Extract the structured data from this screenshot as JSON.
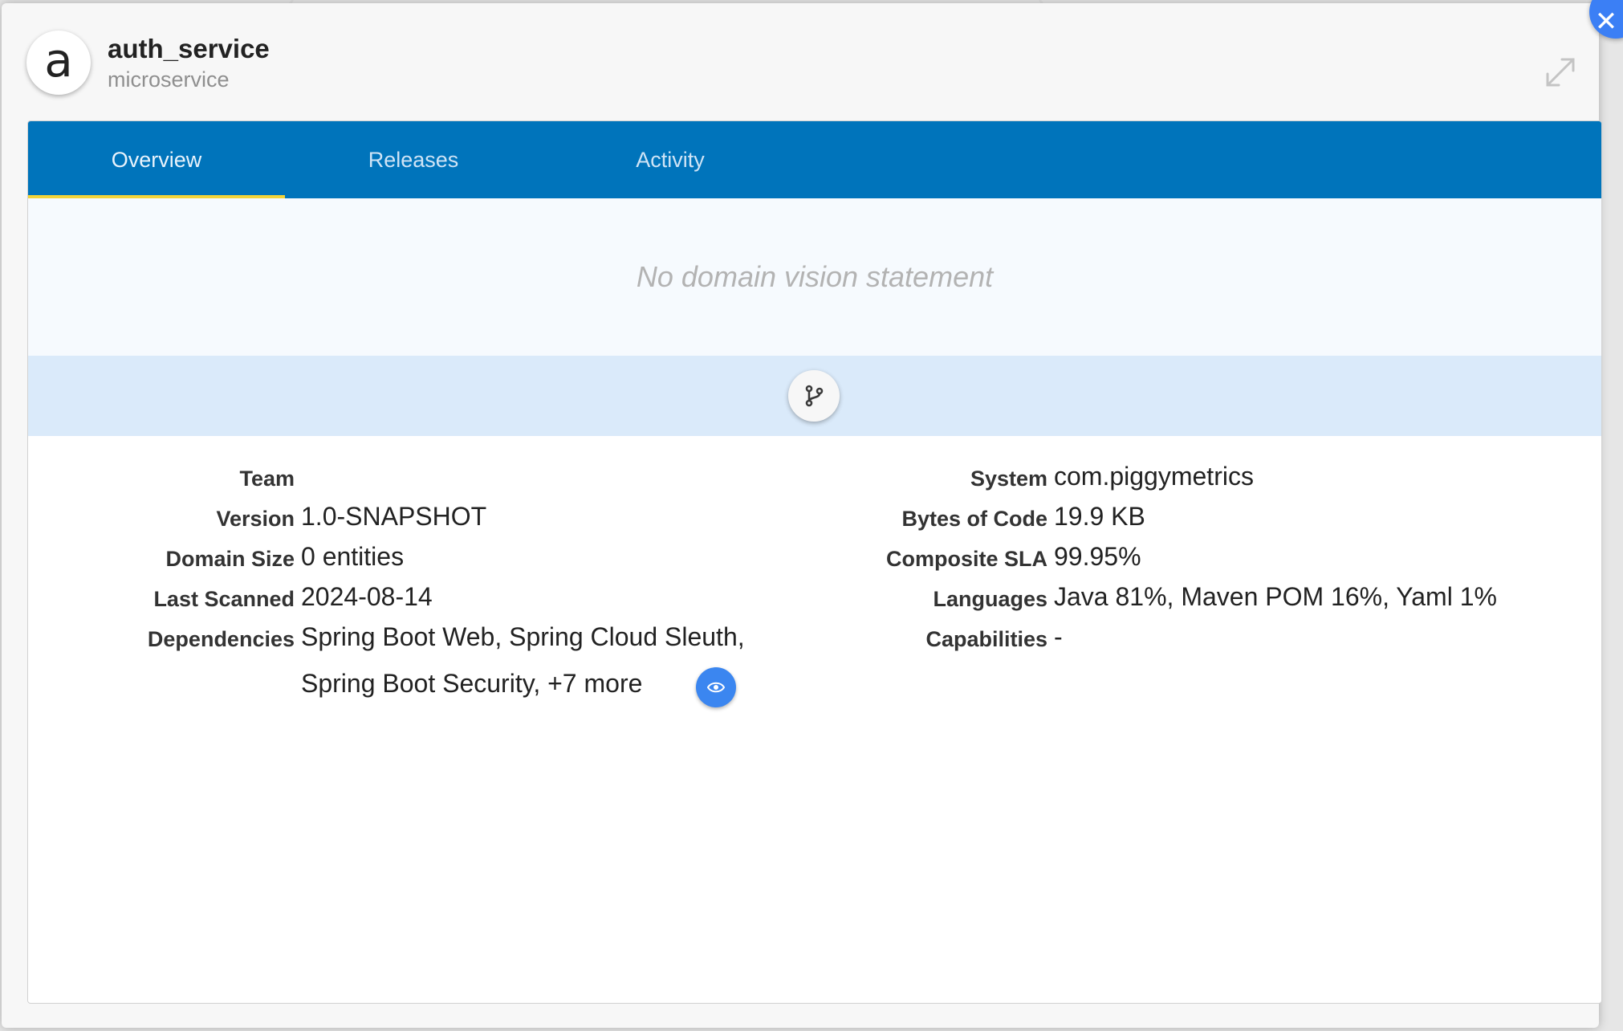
{
  "header": {
    "avatar_letter": "a",
    "title": "auth_service",
    "subtitle": "microservice"
  },
  "tabs": [
    {
      "label": "Overview",
      "active": true
    },
    {
      "label": "Releases",
      "active": false
    },
    {
      "label": "Activity",
      "active": false
    }
  ],
  "vision_statement": "No domain vision statement",
  "details_left": [
    {
      "label": "Team",
      "value": ""
    },
    {
      "label": "Version",
      "value": "1.0-SNAPSHOT"
    },
    {
      "label": "Domain Size",
      "value": "0 entities"
    },
    {
      "label": "Last Scanned",
      "value": "2024-08-14"
    },
    {
      "label": "Dependencies",
      "value_line1": "Spring Boot Web, Spring Cloud Sleuth,",
      "value_line2": "Spring Boot Security, +7 more"
    }
  ],
  "details_right": [
    {
      "label": "System",
      "value": "com.piggymetrics"
    },
    {
      "label": "Bytes of Code",
      "value": "19.9 KB"
    },
    {
      "label": "Composite SLA",
      "value": "99.95%"
    },
    {
      "label": "Languages",
      "value": "Java 81%, Maven POM 16%, Yaml 1%"
    },
    {
      "label": "Capabilities",
      "value": "-"
    }
  ],
  "icons": {
    "close": "close-icon",
    "expand": "expand-icon",
    "graph": "git-branch-icon",
    "view_dependencies": "eye-icon"
  },
  "colors": {
    "tab_bar": "#0074bb",
    "tab_underline": "#f2d43a",
    "accent_button": "#3b86f0"
  }
}
